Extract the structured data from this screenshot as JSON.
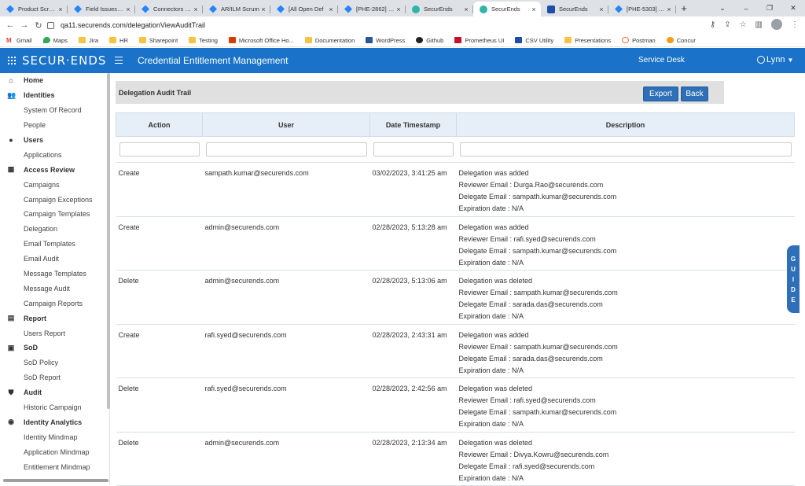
{
  "browser": {
    "tabs": [
      {
        "label": "Product Scrum",
        "icon": "jira-icon",
        "active": false
      },
      {
        "label": "Field Issues Ka",
        "icon": "jira-icon",
        "active": false
      },
      {
        "label": "Connectors Sc",
        "icon": "jira-icon",
        "active": false
      },
      {
        "label": "AR/ILM Scrum",
        "icon": "jira-icon",
        "active": false
      },
      {
        "label": "[All Open Def",
        "icon": "jira-icon",
        "active": false
      },
      {
        "label": "[PHE-2862] De",
        "icon": "jira-icon",
        "active": false
      },
      {
        "label": "SecurEnds",
        "icon": "securends-icon",
        "active": false
      },
      {
        "label": "SecurEnds",
        "icon": "securends-icon",
        "active": true
      },
      {
        "label": "SecurEnds",
        "icon": "securends-dark-icon",
        "active": false
      },
      {
        "label": "[PHE-5303] Ca",
        "icon": "jira-icon",
        "active": false
      }
    ],
    "new_tab": "+",
    "url": "qa11.securends.com/delegationViewAuditTrail",
    "bookmarks": [
      {
        "label": "Gmail",
        "icon": "gmail-icon"
      },
      {
        "label": "Maps",
        "icon": "maps-icon"
      },
      {
        "label": "Jira",
        "icon": "folder-icon"
      },
      {
        "label": "HR",
        "icon": "folder-icon"
      },
      {
        "label": "Sharepoint",
        "icon": "folder-icon"
      },
      {
        "label": "Testing",
        "icon": "folder-icon"
      },
      {
        "label": "Microsoft Office Ho...",
        "icon": "office-icon"
      },
      {
        "label": "Documentation",
        "icon": "folder-icon"
      },
      {
        "label": "WordPress",
        "icon": "wordpress-icon"
      },
      {
        "label": "Github",
        "icon": "github-icon"
      },
      {
        "label": "Prometheus UI",
        "icon": "prometheus-icon"
      },
      {
        "label": "CSV Utility",
        "icon": "csv-icon"
      },
      {
        "label": "Presentations",
        "icon": "folder-icon"
      },
      {
        "label": "Postman",
        "icon": "postman-icon"
      },
      {
        "label": "Concur",
        "icon": "concur-icon"
      }
    ]
  },
  "header": {
    "logo": "SECUR·ENDS",
    "title": "Credential Entitlement Management",
    "service_desk": "Service Desk",
    "user": "Lynn"
  },
  "sidebar": {
    "sections": [
      {
        "label": "Home",
        "icon": "home-icon",
        "items": []
      },
      {
        "label": "Identities",
        "icon": "people-icon",
        "items": [
          "System Of Record",
          "People"
        ]
      },
      {
        "label": "Users",
        "icon": "user-icon",
        "items": [
          "Applications"
        ]
      },
      {
        "label": "Access Review",
        "icon": "grid-icon",
        "items": [
          "Campaigns",
          "Campaign Exceptions",
          "Campaign Templates",
          "Delegation",
          "Email Templates",
          "Email Audit",
          "Message Templates",
          "Message Audit",
          "Campaign Reports"
        ]
      },
      {
        "label": "Report",
        "icon": "report-icon",
        "items": [
          "Users Report"
        ]
      },
      {
        "label": "SoD",
        "icon": "sod-icon",
        "items": [
          "SoD Policy",
          "SoD Report"
        ]
      },
      {
        "label": "Audit",
        "icon": "shield-icon",
        "items": [
          "Historic Campaign"
        ]
      },
      {
        "label": "Identity Analytics",
        "icon": "analytics-icon",
        "items": [
          "Identity Mindmap",
          "Application Mindmap",
          "Entitlement Mindmap"
        ]
      }
    ]
  },
  "main": {
    "panel_title": "Delegation Audit Trail",
    "export_label": "Export",
    "back_label": "Back",
    "columns": [
      "Action",
      "User",
      "Date Timestamp",
      "Description"
    ],
    "rows": [
      {
        "action": "Create",
        "user": "sampath.kumar@securends.com",
        "timestamp": "03/02/2023, 3:41:25 am",
        "description": [
          "Delegation was added",
          "Reviewer Email : Durga.Rao@securends.com",
          "Delegate Email : sampath.kumar@securends.com",
          "Expiration date : N/A"
        ]
      },
      {
        "action": "Create",
        "user": "admin@securends.com",
        "timestamp": "02/28/2023, 5:13:28 am",
        "description": [
          "Delegation was added",
          "Reviewer Email : rafi.syed@securends.com",
          "Delegate Email : sampath.kumar@securends.com",
          "Expiration date : N/A"
        ]
      },
      {
        "action": "Delete",
        "user": "admin@securends.com",
        "timestamp": "02/28/2023, 5:13:06 am",
        "description": [
          "Delegation was deleted",
          "Reviewer Email : sampath.kumar@securends.com",
          "Delegate Email : sarada.das@securends.com",
          "Expiration date : N/A"
        ]
      },
      {
        "action": "Create",
        "user": "rafi.syed@securends.com",
        "timestamp": "02/28/2023, 2:43:31 am",
        "description": [
          "Delegation was added",
          "Reviewer Email : sampath.kumar@securends.com",
          "Delegate Email : sarada.das@securends.com",
          "Expiration date : N/A"
        ]
      },
      {
        "action": "Delete",
        "user": "rafi.syed@securends.com",
        "timestamp": "02/28/2023, 2:42:56 am",
        "description": [
          "Delegation was deleted",
          "Reviewer Email : rafi.syed@securends.com",
          "Delegate Email : sampath.kumar@securends.com",
          "Expiration date : N/A"
        ]
      },
      {
        "action": "Delete",
        "user": "admin@securends.com",
        "timestamp": "02/28/2023, 2:13:34 am",
        "description": [
          "Delegation was deleted",
          "Reviewer Email : Divya.Kowru@securends.com",
          "Delegate Email : rafi.syed@securends.com",
          "Expiration date : N/A"
        ]
      }
    ]
  },
  "guide": [
    "G",
    "U",
    "I",
    "D",
    "E"
  ],
  "colors": {
    "header_bg": "#1a73c9",
    "button_bg": "#2e6fb7",
    "table_header_bg": "#e6eef8"
  }
}
